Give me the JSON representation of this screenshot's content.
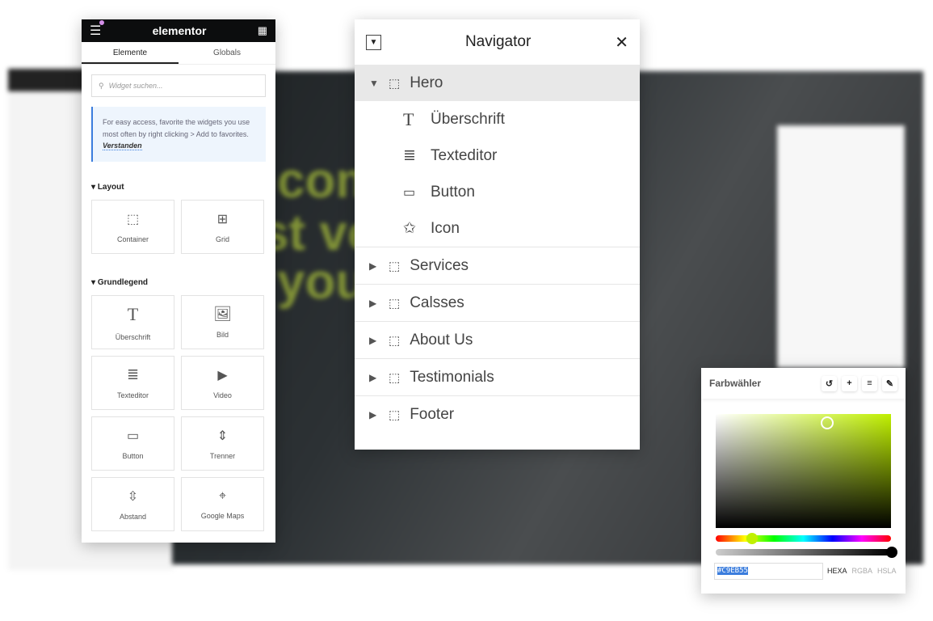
{
  "background": {
    "hero_text": [
      "com",
      "st ve",
      "you"
    ]
  },
  "elements_panel": {
    "logo": "elementor",
    "tabs": [
      {
        "label": "Elemente",
        "active": true
      },
      {
        "label": "Globals",
        "active": false
      }
    ],
    "search_placeholder": "Widget suchen...",
    "info_text": "For easy access, favorite the widgets you use most often by right clicking > Add to favorites.",
    "info_link": "Verstanden",
    "sections": [
      {
        "title": "Layout",
        "widgets": [
          {
            "label": "Container",
            "icon": "container-icon"
          },
          {
            "label": "Grid",
            "icon": "grid-icon"
          }
        ]
      },
      {
        "title": "Grundlegend",
        "widgets": [
          {
            "label": "Überschrift",
            "icon": "heading-icon"
          },
          {
            "label": "Bild",
            "icon": "image-icon"
          },
          {
            "label": "Texteditor",
            "icon": "text-editor-icon"
          },
          {
            "label": "Video",
            "icon": "video-icon"
          },
          {
            "label": "Button",
            "icon": "button-icon"
          },
          {
            "label": "Trenner",
            "icon": "divider-icon"
          },
          {
            "label": "Abstand",
            "icon": "spacer-icon"
          },
          {
            "label": "Google Maps",
            "icon": "map-icon"
          }
        ]
      }
    ]
  },
  "navigator": {
    "title": "Navigator",
    "hero": {
      "label": "Hero",
      "children": [
        {
          "label": "Überschrift",
          "glyph": "T"
        },
        {
          "label": "Texteditor",
          "glyph": "≣"
        },
        {
          "label": "Button",
          "glyph": "⌨"
        },
        {
          "label": "Icon",
          "glyph": "☆"
        }
      ]
    },
    "sections": [
      "Services",
      "Calsses",
      "About Us",
      "Testimonials",
      "Footer"
    ]
  },
  "color_picker": {
    "title": "Farbwähler",
    "value": "#C9EB55",
    "modes": [
      "HEXA",
      "RGBA",
      "HSLA"
    ],
    "active_mode": "HEXA",
    "alpha": 1
  }
}
